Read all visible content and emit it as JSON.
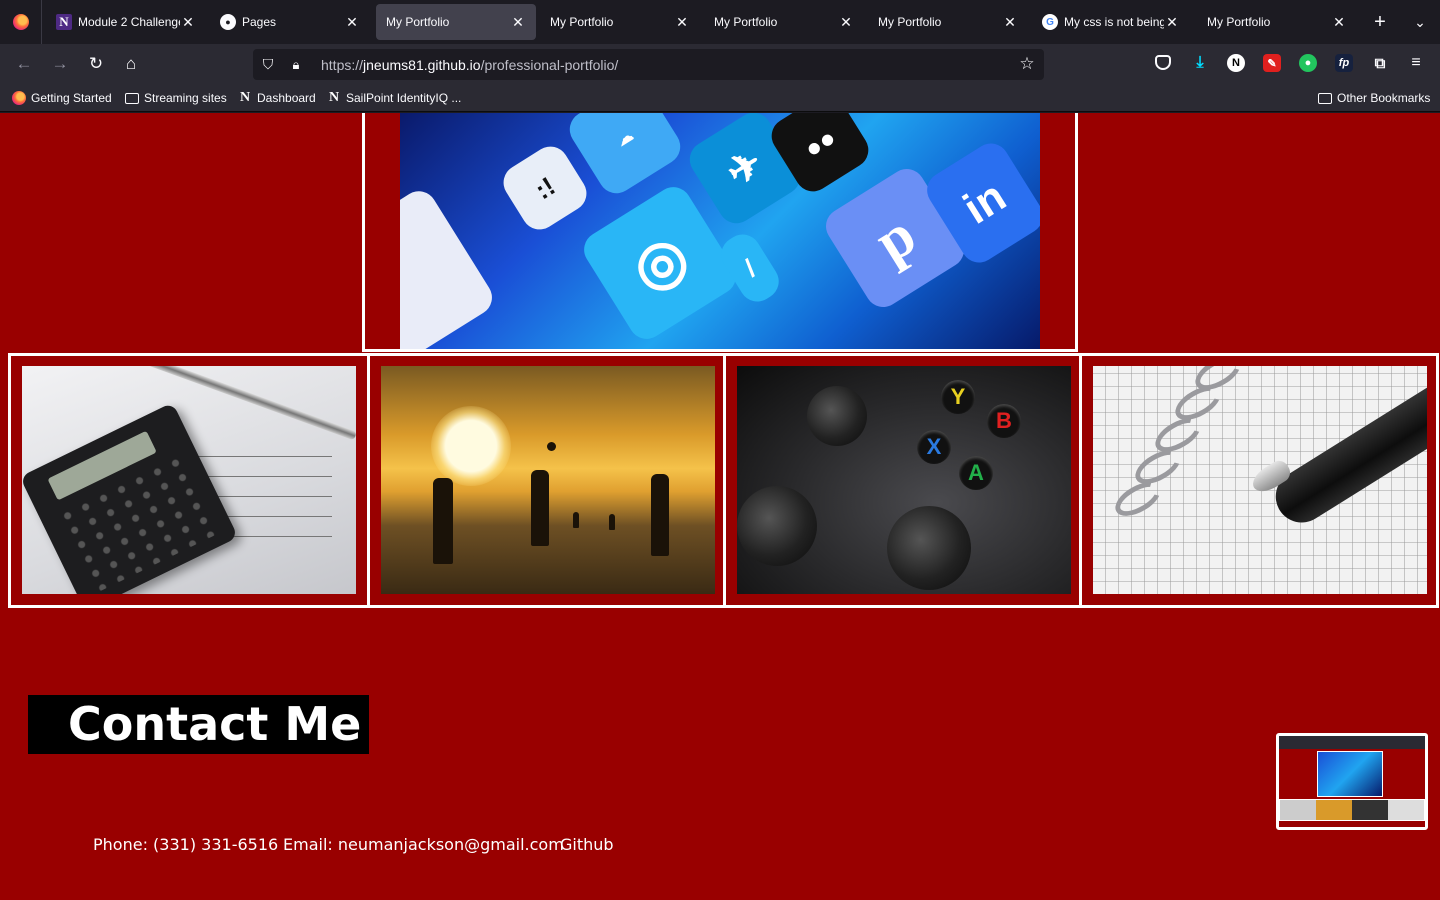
{
  "browser": {
    "tabs": [
      {
        "label": "Module 2 Challenge",
        "favicon": "northwestern-icon",
        "active": false
      },
      {
        "label": "Pages",
        "favicon": "github-icon",
        "active": false
      },
      {
        "label": "My Portfolio",
        "favicon": "",
        "active": true
      },
      {
        "label": "My Portfolio",
        "favicon": "",
        "active": false
      },
      {
        "label": "My Portfolio",
        "favicon": "",
        "active": false
      },
      {
        "label": "My Portfolio",
        "favicon": "",
        "active": false
      },
      {
        "label": "My css is not being",
        "favicon": "google-icon",
        "active": false
      },
      {
        "label": "My Portfolio",
        "favicon": "",
        "active": false
      }
    ],
    "url_prefix": "https://",
    "url_host": "jneums81.github.io",
    "url_path": "/professional-portfolio/",
    "bookmarks": [
      {
        "label": "Getting Started",
        "icon": "firefox-icon"
      },
      {
        "label": "Streaming sites",
        "icon": "folder-icon"
      },
      {
        "label": "Dashboard",
        "icon": "northwestern-icon"
      },
      {
        "label": "SailPoint IdentityIQ ...",
        "icon": "northwestern-icon"
      }
    ],
    "other_bookmarks": "Other Bookmarks",
    "extension_icons": [
      "pocket-icon",
      "download-icon",
      "notion-icon",
      "pdf-icon",
      "green-extension-icon",
      "fp-icon",
      "extensions-icon",
      "menu-icon"
    ]
  },
  "page": {
    "background_color": "#990000",
    "gallery": [
      {
        "name": "calculator-photo"
      },
      {
        "name": "beach-sunset-photo"
      },
      {
        "name": "game-controller-photo"
      },
      {
        "name": "notebook-pen-photo"
      }
    ],
    "contact": {
      "title": "Contact Me",
      "phone": "Phone: (331) 331-6516",
      "email": "Email: neumanjackson@gmail.com",
      "github": "Github"
    }
  }
}
